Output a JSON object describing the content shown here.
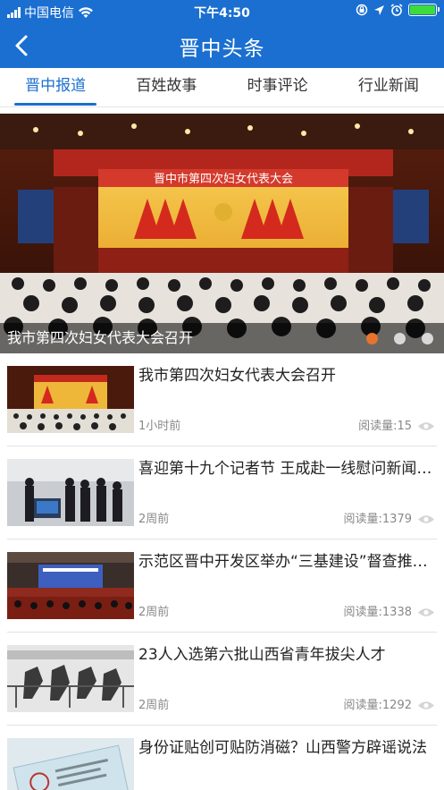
{
  "status_bar": {
    "carrier": "中国电信",
    "time": "下午4:50"
  },
  "nav": {
    "title": "晋中头条"
  },
  "tabs": [
    {
      "label": "晋中报道",
      "active": true
    },
    {
      "label": "百姓故事",
      "active": false
    },
    {
      "label": "时事评论",
      "active": false
    },
    {
      "label": "行业新闻",
      "active": false
    }
  ],
  "banner": {
    "caption": "我市第四次妇女代表大会召开",
    "stage_banner_text": "晋中市第四次妇女代表大会",
    "slide_count": 3,
    "active_slide": 1
  },
  "news": [
    {
      "title": "我市第四次妇女代表大会召开",
      "time": "1小时前",
      "reads": "阅读量:15"
    },
    {
      "title": "喜迎第十九个记者节 王成赴一线慰问新闻工作者",
      "time": "2周前",
      "reads": "阅读量:1379"
    },
    {
      "title": "示范区晋中开发区举办“三基建设”督查推进会",
      "time": "2周前",
      "reads": "阅读量:1338"
    },
    {
      "title": "23人入选第六批山西省青年拔尖人才",
      "time": "2周前",
      "reads": "阅读量:1292"
    },
    {
      "title": "身份证贴创可贴防消磁？山西警方辟谣说法",
      "time": "",
      "reads": ""
    }
  ],
  "colors": {
    "brand_blue": "#1a6fd0",
    "active_dot": "#e8732c",
    "battery_green": "#3ddc3d"
  }
}
